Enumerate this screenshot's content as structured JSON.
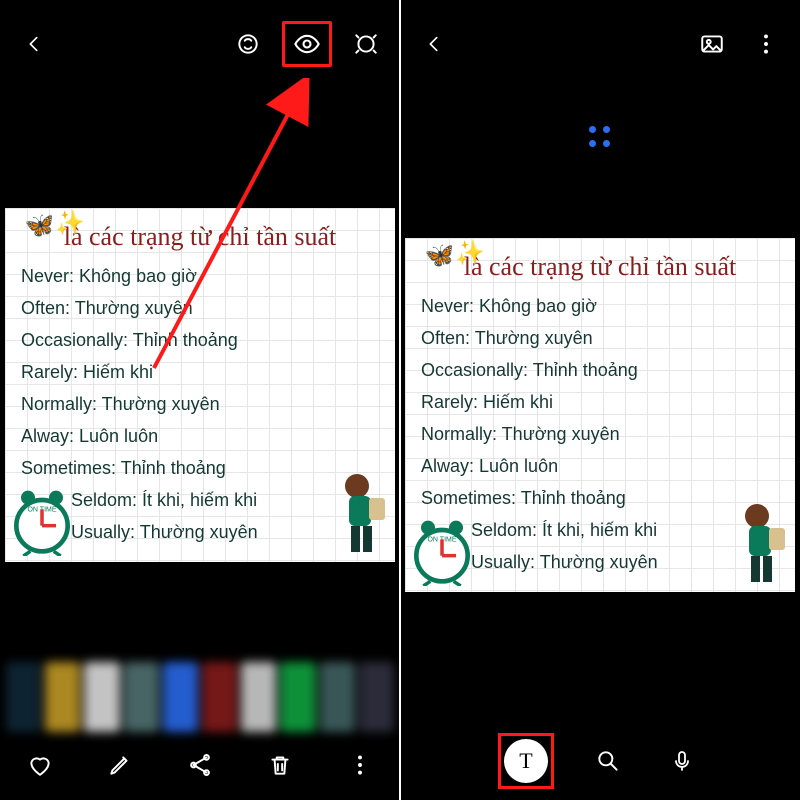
{
  "card": {
    "title": "là các trạng từ chỉ tần suất",
    "rows": [
      "Never: Không bao giờ",
      "Often: Thường xuyên",
      "Occasionally: Thỉnh thoảng",
      "Rarely: Hiếm khi",
      "Normally: Thường xuyên",
      "Alway: Luôn luôn",
      "Sometimes: Thỉnh thoảng",
      "Seldom: Ít khi, hiếm khi",
      "Usually: Thường xuyên"
    ]
  },
  "left": {
    "icons": {
      "back": "back",
      "ai_enhance": "ai-enhance",
      "eye": "eye-view",
      "lens": "lens"
    },
    "bottom": {
      "heart": "favorite",
      "edit": "edit",
      "share": "share",
      "trash": "delete",
      "more": "more"
    }
  },
  "right": {
    "icons": {
      "back": "back",
      "gallery": "gallery",
      "more": "more"
    },
    "bottom": {
      "text": "T",
      "search": "search",
      "mic": "mic"
    }
  },
  "thumb_colors": [
    "#102a3a",
    "#caa028",
    "#e6e6e6",
    "#577",
    "#2b6ef2",
    "#8a1d1d",
    "#d8d8d8",
    "#1a4",
    "#466",
    "#334"
  ]
}
